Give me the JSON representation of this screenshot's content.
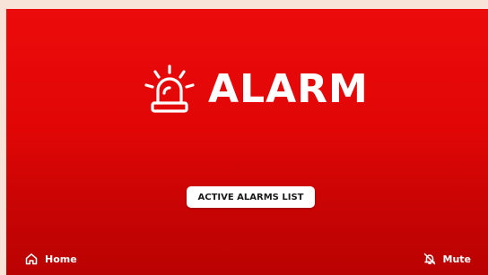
{
  "screen": {
    "title": "ALARM",
    "icon": "siren-icon",
    "background_top": "#ec0b0b",
    "background_bottom": "#ba0202"
  },
  "actions": {
    "active_alarms_label": "ACTIVE ALARMS LIST"
  },
  "footer": {
    "home_label": "Home",
    "home_icon": "home-icon",
    "mute_label": "Mute",
    "mute_icon": "bell-off-icon"
  }
}
